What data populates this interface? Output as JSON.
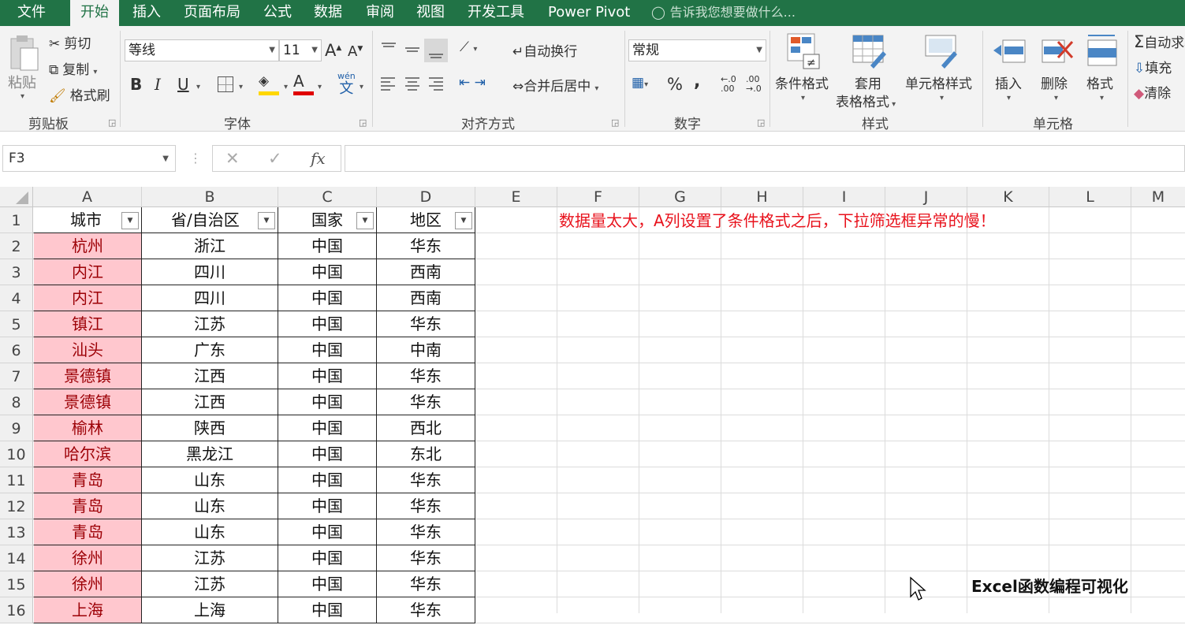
{
  "tabs": [
    "文件",
    "开始",
    "插入",
    "页面布局",
    "公式",
    "数据",
    "审阅",
    "视图",
    "开发工具",
    "Power Pivot"
  ],
  "active_tab": "开始",
  "tell_me": "告诉我您想要做什么...",
  "ribbon": {
    "clipboard": {
      "paste": "粘贴",
      "cut": "剪切",
      "copy": "复制",
      "format_painter": "格式刷",
      "label": "剪贴板"
    },
    "font": {
      "font_name": "等线",
      "font_size": "11",
      "label": "字体",
      "bold": "B",
      "italic": "I",
      "underline": "U",
      "pinyin_top": "wén",
      "pinyin_bottom": "文"
    },
    "alignment": {
      "wrap": "自动换行",
      "merge": "合并后居中",
      "label": "对齐方式"
    },
    "number": {
      "format": "常规",
      "percent": "%",
      "comma": ",",
      "inc_decimal_top": "←.0",
      "inc_decimal_bottom": ".00",
      "dec_decimal_top": ".00",
      "dec_decimal_bottom": "→.0",
      "label": "数字"
    },
    "styles": {
      "cond_format": "条件格式",
      "table_format_1": "套用",
      "table_format_2": "表格格式",
      "cell_styles": "单元格样式",
      "label": "样式"
    },
    "cells": {
      "insert": "插入",
      "delete": "删除",
      "format": "格式",
      "label": "单元格"
    },
    "editing": {
      "autosum": "自动求和",
      "fill": "填充",
      "clear": "清除"
    }
  },
  "formula_bar": {
    "name_box": "F3",
    "cancel": "✕",
    "enter": "✓",
    "fx": "fx",
    "formula": ""
  },
  "columns": [
    "A",
    "B",
    "C",
    "D",
    "E",
    "F",
    "G",
    "H",
    "I",
    "J",
    "K",
    "L",
    "M"
  ],
  "header_row": {
    "row": "1",
    "cells": [
      "城市",
      "省/自治区",
      "国家",
      "地区"
    ]
  },
  "rows": [
    {
      "row": "2",
      "cells": [
        "杭州",
        "浙江",
        "中国",
        "华东"
      ]
    },
    {
      "row": "3",
      "cells": [
        "内江",
        "四川",
        "中国",
        "西南"
      ]
    },
    {
      "row": "4",
      "cells": [
        "内江",
        "四川",
        "中国",
        "西南"
      ]
    },
    {
      "row": "5",
      "cells": [
        "镇江",
        "江苏",
        "中国",
        "华东"
      ]
    },
    {
      "row": "6",
      "cells": [
        "汕头",
        "广东",
        "中国",
        "中南"
      ]
    },
    {
      "row": "7",
      "cells": [
        "景德镇",
        "江西",
        "中国",
        "华东"
      ]
    },
    {
      "row": "8",
      "cells": [
        "景德镇",
        "江西",
        "中国",
        "华东"
      ]
    },
    {
      "row": "9",
      "cells": [
        "榆林",
        "陕西",
        "中国",
        "西北"
      ]
    },
    {
      "row": "10",
      "cells": [
        "哈尔滨",
        "黑龙江",
        "中国",
        "东北"
      ]
    },
    {
      "row": "11",
      "cells": [
        "青岛",
        "山东",
        "中国",
        "华东"
      ]
    },
    {
      "row": "12",
      "cells": [
        "青岛",
        "山东",
        "中国",
        "华东"
      ]
    },
    {
      "row": "13",
      "cells": [
        "青岛",
        "山东",
        "中国",
        "华东"
      ]
    },
    {
      "row": "14",
      "cells": [
        "徐州",
        "江苏",
        "中国",
        "华东"
      ]
    },
    {
      "row": "15",
      "cells": [
        "徐州",
        "江苏",
        "中国",
        "华东"
      ]
    },
    {
      "row": "16",
      "cells": [
        "上海",
        "上海",
        "中国",
        "华东"
      ]
    }
  ],
  "note_text": "数据量太大，A列设置了条件格式之后，下拉筛选框异常的慢！",
  "watermark": "Excel函数编程可视化",
  "colors": {
    "accent": "#217346",
    "cf_fill": "#ffc7ce",
    "cf_text": "#9c0006",
    "note": "#e8121c"
  }
}
